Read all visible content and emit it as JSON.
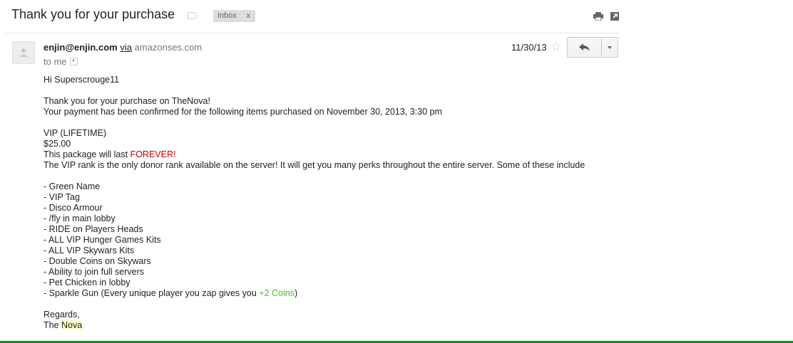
{
  "email": {
    "subject": "Thank you for your purchase",
    "tag": {
      "label": "Inbox",
      "close": "x"
    },
    "sender": {
      "email": "enjin@enjin.com",
      "via": "via",
      "domain": "amazonses.com"
    },
    "recipient": "to me",
    "date": "11/30/13",
    "icons": {
      "label": "label-icon",
      "print": "print-icon",
      "new_window": "new-window-icon",
      "star": "star-icon",
      "reply": "reply-icon",
      "more": "chevron-down-icon",
      "avatar": "avatar-icon"
    },
    "body": {
      "greeting": "Hi Superscrouge11",
      "thanks": "Thank you for your purchase on TheNova!",
      "confirmation": "Your payment has been confirmed for the following items purchased on November 30, 2013, 3:30 pm",
      "item_name": "VIP (LIFETIME)",
      "item_price": "$25.00",
      "duration_prefix": "This package will last ",
      "duration_highlight": "FOREVER!",
      "description": "The VIP rank is the only donor rank available on the server! It will get you many perks throughout the entire server. Some of these include",
      "perks": [
        "- Green Name",
        "- VIP Tag",
        "- Disco Armour",
        "- /fly in main lobby",
        "- RIDE on Players Heads",
        "- ALL VIP Hunger Games Kits",
        "- ALL VIP Skywars Kits",
        "- Double Coins on Skywars",
        "- Ability to join full servers",
        "- Pet Chicken in lobby"
      ],
      "last_perk_prefix": "- Sparkle Gun (Every unique player you zap gives you ",
      "last_perk_highlight": "+2 Coins",
      "last_perk_suffix": ")",
      "sign_off": "Regards,",
      "sign_prefix": "The ",
      "sign_name": "Nova"
    }
  },
  "colors": {
    "accent_red": "#cc0000",
    "accent_green": "#55b830",
    "highlight": "#ffffcc",
    "bottom_bar": "#1a8c1a"
  }
}
